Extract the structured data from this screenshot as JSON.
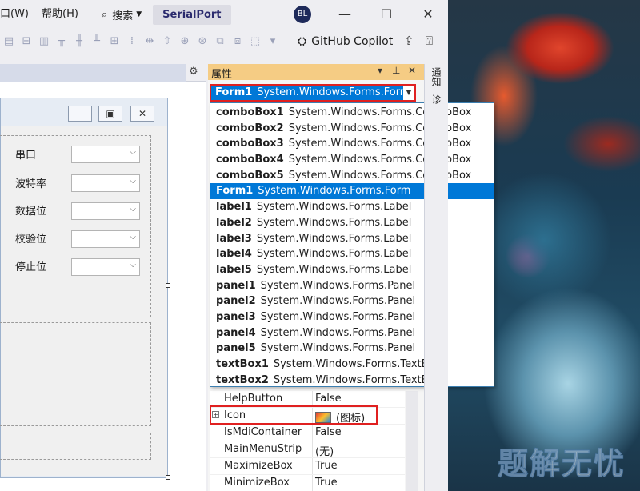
{
  "menu": {
    "window": "口(W)",
    "help": "帮助(H)",
    "search": "搜索",
    "solution": "SerialPort",
    "avatar": "BL"
  },
  "toolbar": {
    "copilot": "GitHub Copilot"
  },
  "form_designer": {
    "labels": [
      "串口",
      "波特率",
      "数据位",
      "校验位",
      "停止位"
    ]
  },
  "properties": {
    "title": "属性",
    "selected_object": {
      "name": "Form1",
      "type": "System.Windows.Forms.Form"
    },
    "dropdown": [
      {
        "name": "comboBox1",
        "type": "System.Windows.Forms.ComboBox"
      },
      {
        "name": "comboBox2",
        "type": "System.Windows.Forms.ComboBox"
      },
      {
        "name": "comboBox3",
        "type": "System.Windows.Forms.ComboBox"
      },
      {
        "name": "comboBox4",
        "type": "System.Windows.Forms.ComboBox"
      },
      {
        "name": "comboBox5",
        "type": "System.Windows.Forms.ComboBox"
      },
      {
        "name": "Form1",
        "type": "System.Windows.Forms.Form"
      },
      {
        "name": "label1",
        "type": "System.Windows.Forms.Label"
      },
      {
        "name": "label2",
        "type": "System.Windows.Forms.Label"
      },
      {
        "name": "label3",
        "type": "System.Windows.Forms.Label"
      },
      {
        "name": "label4",
        "type": "System.Windows.Forms.Label"
      },
      {
        "name": "label5",
        "type": "System.Windows.Forms.Label"
      },
      {
        "name": "panel1",
        "type": "System.Windows.Forms.Panel"
      },
      {
        "name": "panel2",
        "type": "System.Windows.Forms.Panel"
      },
      {
        "name": "panel3",
        "type": "System.Windows.Forms.Panel"
      },
      {
        "name": "panel4",
        "type": "System.Windows.Forms.Panel"
      },
      {
        "name": "panel5",
        "type": "System.Windows.Forms.Panel"
      },
      {
        "name": "textBox1",
        "type": "System.Windows.Forms.TextBox"
      },
      {
        "name": "textBox2",
        "type": "System.Windows.Forms.TextBox"
      }
    ],
    "rows": [
      {
        "name": "HelpButton",
        "value": "False"
      },
      {
        "name": "Icon",
        "value": "(图标)"
      },
      {
        "name": "IsMdiContainer",
        "value": "False"
      },
      {
        "name": "MainMenuStrip",
        "value": "(无)"
      },
      {
        "name": "MaximizeBox",
        "value": "True"
      },
      {
        "name": "MinimizeBox",
        "value": "True"
      }
    ]
  },
  "side_tabs": [
    "通知",
    "诊"
  ],
  "watermark": "题解无忧",
  "colors": {
    "selection": "#0078d7",
    "highlight_box": "#e02020",
    "props_header": "#f5cc84"
  }
}
